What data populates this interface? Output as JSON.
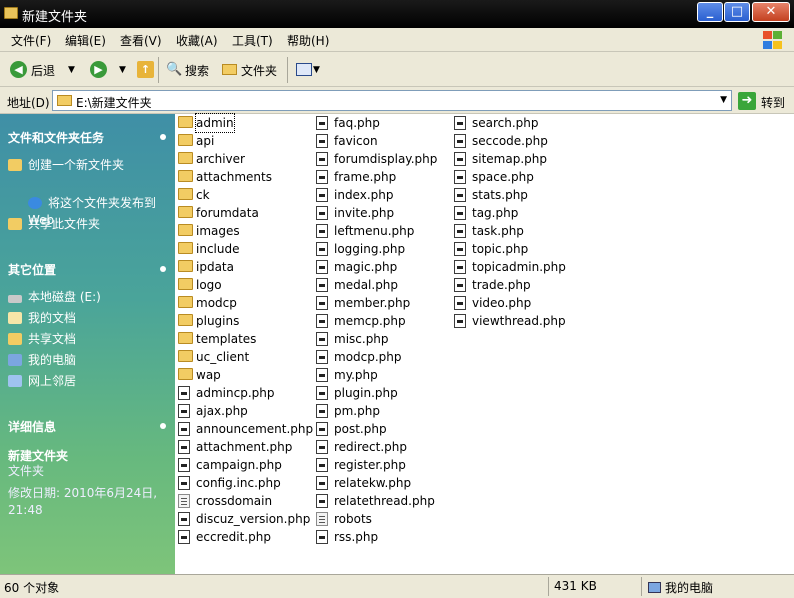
{
  "window": {
    "title": "新建文件夹"
  },
  "menu": [
    "文件(F)",
    "编辑(E)",
    "查看(V)",
    "收藏(A)",
    "工具(T)",
    "帮助(H)"
  ],
  "toolbar": {
    "back": "后退",
    "search": "搜索",
    "folders": "文件夹"
  },
  "address": {
    "label": "地址(D)",
    "value": "E:\\新建文件夹",
    "go": "转到"
  },
  "tasks": {
    "title": "文件和文件夹任务",
    "items": [
      "创建一个新文件夹",
      "将这个文件夹发布到\nWeb",
      "共享此文件夹"
    ]
  },
  "places": {
    "title": "其它位置",
    "items": [
      "本地磁盘 (E:)",
      "我的文档",
      "共享文档",
      "我的电脑",
      "网上邻居"
    ]
  },
  "details": {
    "title": "详细信息",
    "name": "新建文件夹",
    "type": "文件夹",
    "modified_label": "修改日期: 2010年6月24日,",
    "modified_time": "21:48"
  },
  "files": {
    "col1": [
      {
        "name": "admin",
        "kind": "folder"
      },
      {
        "name": "api",
        "kind": "folder"
      },
      {
        "name": "archiver",
        "kind": "folder"
      },
      {
        "name": "attachments",
        "kind": "folder"
      },
      {
        "name": "ck",
        "kind": "folder"
      },
      {
        "name": "forumdata",
        "kind": "folder"
      },
      {
        "name": "images",
        "kind": "folder"
      },
      {
        "name": "include",
        "kind": "folder"
      },
      {
        "name": "ipdata",
        "kind": "folder"
      },
      {
        "name": "logo",
        "kind": "folder"
      },
      {
        "name": "modcp",
        "kind": "folder"
      },
      {
        "name": "plugins",
        "kind": "folder"
      },
      {
        "name": "templates",
        "kind": "folder"
      },
      {
        "name": "uc_client",
        "kind": "folder"
      },
      {
        "name": "wap",
        "kind": "folder"
      },
      {
        "name": "admincp.php",
        "kind": "php"
      },
      {
        "name": "ajax.php",
        "kind": "php"
      },
      {
        "name": "announcement.php",
        "kind": "php"
      },
      {
        "name": "attachment.php",
        "kind": "php"
      },
      {
        "name": "campaign.php",
        "kind": "php"
      },
      {
        "name": "config.inc.php",
        "kind": "php"
      },
      {
        "name": "crossdomain",
        "kind": "gen"
      },
      {
        "name": "discuz_version.php",
        "kind": "php"
      },
      {
        "name": "eccredit.php",
        "kind": "php"
      }
    ],
    "col2": [
      {
        "name": "faq.php",
        "kind": "php"
      },
      {
        "name": "favicon",
        "kind": "php"
      },
      {
        "name": "forumdisplay.php",
        "kind": "php"
      },
      {
        "name": "frame.php",
        "kind": "php"
      },
      {
        "name": "index.php",
        "kind": "php"
      },
      {
        "name": "invite.php",
        "kind": "php"
      },
      {
        "name": "leftmenu.php",
        "kind": "php"
      },
      {
        "name": "logging.php",
        "kind": "php"
      },
      {
        "name": "magic.php",
        "kind": "php"
      },
      {
        "name": "medal.php",
        "kind": "php"
      },
      {
        "name": "member.php",
        "kind": "php"
      },
      {
        "name": "memcp.php",
        "kind": "php"
      },
      {
        "name": "misc.php",
        "kind": "php"
      },
      {
        "name": "modcp.php",
        "kind": "php"
      },
      {
        "name": "my.php",
        "kind": "php"
      },
      {
        "name": "plugin.php",
        "kind": "php"
      },
      {
        "name": "pm.php",
        "kind": "php"
      },
      {
        "name": "post.php",
        "kind": "php"
      },
      {
        "name": "redirect.php",
        "kind": "php"
      },
      {
        "name": "register.php",
        "kind": "php"
      },
      {
        "name": "relatekw.php",
        "kind": "php"
      },
      {
        "name": "relatethread.php",
        "kind": "php"
      },
      {
        "name": "robots",
        "kind": "gen"
      },
      {
        "name": "rss.php",
        "kind": "php"
      }
    ],
    "col3": [
      {
        "name": "search.php",
        "kind": "php"
      },
      {
        "name": "seccode.php",
        "kind": "php"
      },
      {
        "name": "sitemap.php",
        "kind": "php"
      },
      {
        "name": "space.php",
        "kind": "php"
      },
      {
        "name": "stats.php",
        "kind": "php"
      },
      {
        "name": "tag.php",
        "kind": "php"
      },
      {
        "name": "task.php",
        "kind": "php"
      },
      {
        "name": "topic.php",
        "kind": "php"
      },
      {
        "name": "topicadmin.php",
        "kind": "php"
      },
      {
        "name": "trade.php",
        "kind": "php"
      },
      {
        "name": "video.php",
        "kind": "php"
      },
      {
        "name": "viewthread.php",
        "kind": "php"
      }
    ]
  },
  "status": {
    "count": "60 个对象",
    "size": "431 KB",
    "location": "我的电脑"
  }
}
